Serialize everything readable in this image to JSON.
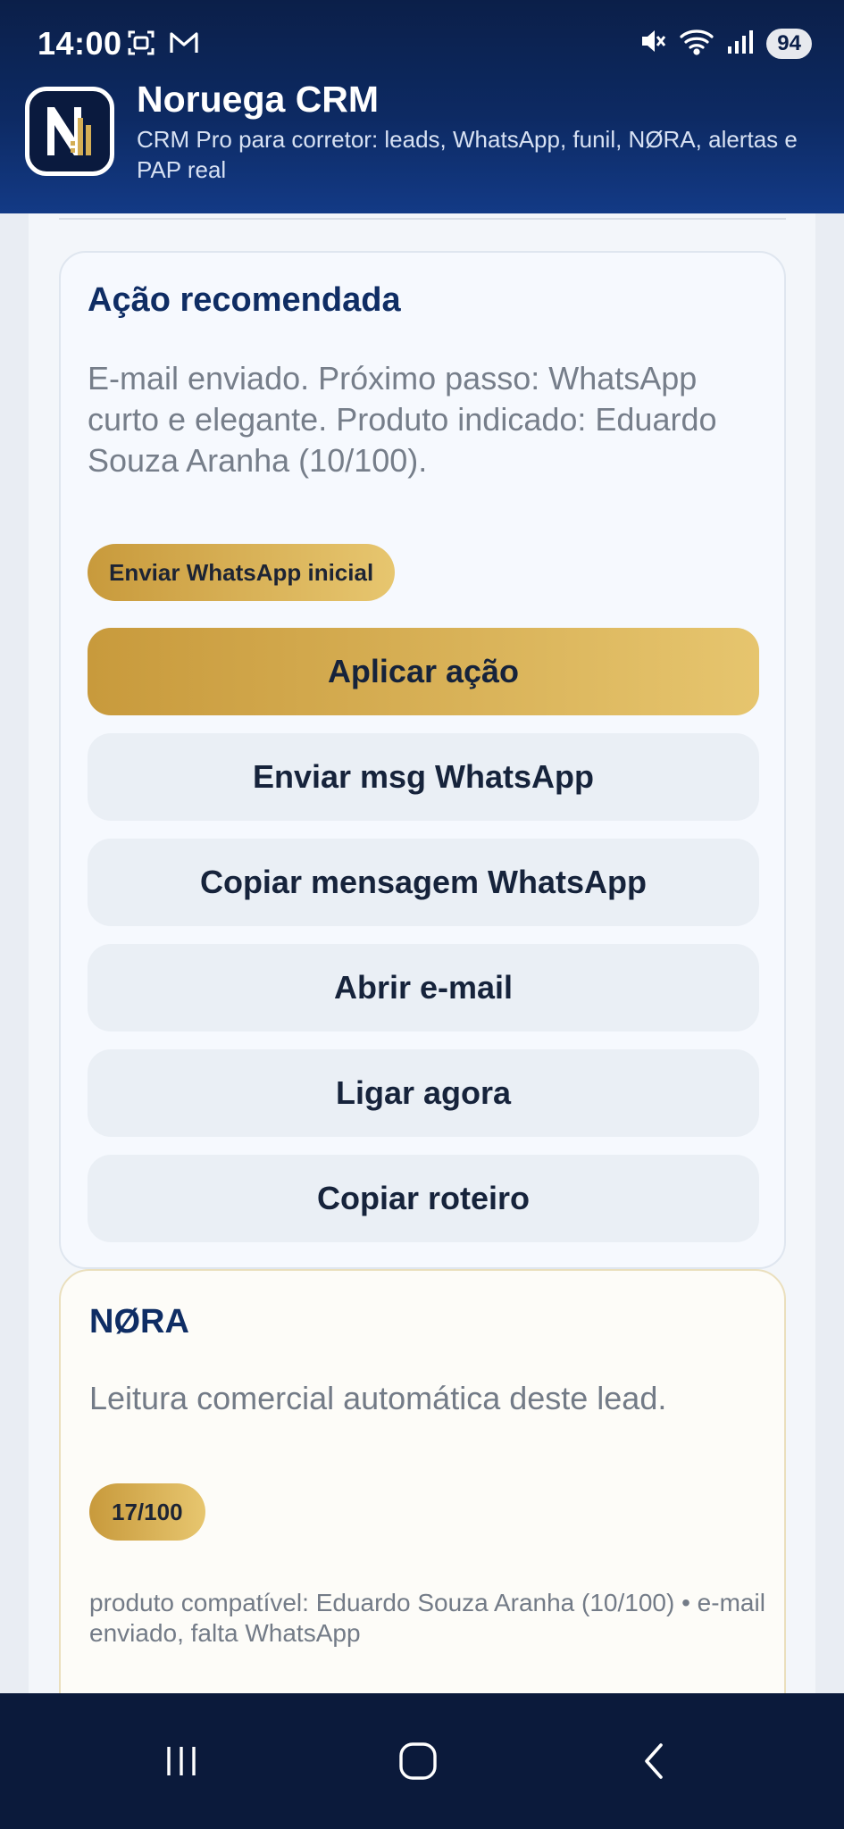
{
  "status_bar": {
    "time": "14:00",
    "battery": "94"
  },
  "header": {
    "title": "Noruega CRM",
    "subtitle": "CRM Pro para corretor: leads, WhatsApp, funil, NØRA, alertas e PAP real"
  },
  "action_card": {
    "title": "Ação recomendada",
    "description": "E-mail enviado. Próximo passo: WhatsApp curto e elegante. Produto indicado: Eduardo Souza Aranha (10/100).",
    "tag": "Enviar WhatsApp inicial",
    "primary_button": "Aplicar ação",
    "buttons": [
      "Enviar msg WhatsApp",
      "Copiar mensagem WhatsApp",
      "Abrir e-mail",
      "Ligar agora",
      "Copiar roteiro"
    ]
  },
  "nora_card": {
    "title": "NØRA",
    "subtitle": "Leitura comercial automática deste lead.",
    "score": "17/100",
    "note": "produto compatível: Eduardo Souza Aranha (10/100) • e-mail enviado, falta WhatsApp"
  },
  "colors": {
    "header_bg": "#0d2a63",
    "gold": "#d4ae55",
    "navy_text": "#0f2d64",
    "nav_bar": "#0b1a3b"
  },
  "icons": {
    "status_left": [
      "screenshot-icon",
      "gmail-icon"
    ],
    "status_right": [
      "mute-icon",
      "wifi-icon",
      "signal-icon"
    ],
    "nav": [
      "recents-icon",
      "home-icon",
      "back-icon"
    ]
  }
}
